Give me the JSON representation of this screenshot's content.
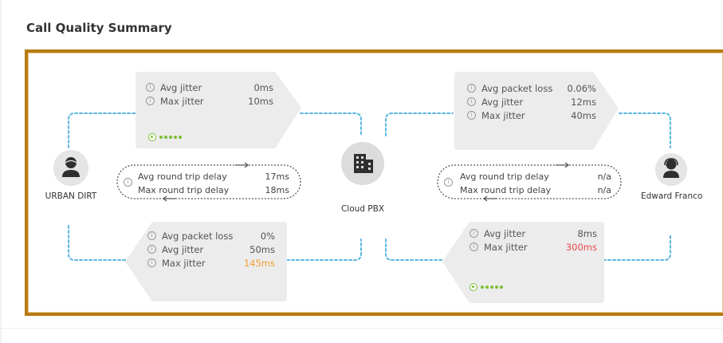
{
  "page_title": "Call Quality Summary",
  "nodes": {
    "left": {
      "label": "URBAN DIRT",
      "icon": "user-icon"
    },
    "center": {
      "label": "Cloud PBX",
      "icon": "building-icon"
    },
    "right": {
      "label": "Edward Franco",
      "icon": "headset-user-icon"
    }
  },
  "cards": {
    "top_left": {
      "rows": [
        {
          "label": "Avg jitter",
          "value": "0ms"
        },
        {
          "label": "Max jitter",
          "value": "10ms"
        }
      ],
      "mos_icon": "mos-quality-icon"
    },
    "bottom_left": {
      "rows": [
        {
          "label": "Avg packet loss",
          "value": "0%"
        },
        {
          "label": "Avg jitter",
          "value": "50ms"
        },
        {
          "label": "Max jitter",
          "value": "145ms"
        }
      ]
    },
    "top_right": {
      "rows": [
        {
          "label": "Avg packet loss",
          "value": "0.06%"
        },
        {
          "label": "Avg jitter",
          "value": "12ms"
        },
        {
          "label": "Max jitter",
          "value": "40ms"
        }
      ]
    },
    "bottom_right": {
      "rows": [
        {
          "label": "Avg jitter",
          "value": "8ms"
        },
        {
          "label": "Max jitter",
          "value": "300ms"
        }
      ],
      "mos_icon": "mos-quality-icon"
    }
  },
  "round_trip": {
    "left": {
      "avg_label": "Avg round trip delay",
      "avg_value": "17ms",
      "max_label": "Max round trip delay",
      "max_value": "18ms"
    },
    "right": {
      "avg_label": "Avg round trip delay",
      "avg_value": "n/a",
      "max_label": "Max round trip delay",
      "max_value": "n/a"
    }
  },
  "colors": {
    "frame": "#b87c14",
    "connector": "#5bb6e0",
    "card_bg": "#ececec",
    "warning": "#f0a030",
    "critical": "#e84a4a",
    "good": "#7cbd32"
  }
}
